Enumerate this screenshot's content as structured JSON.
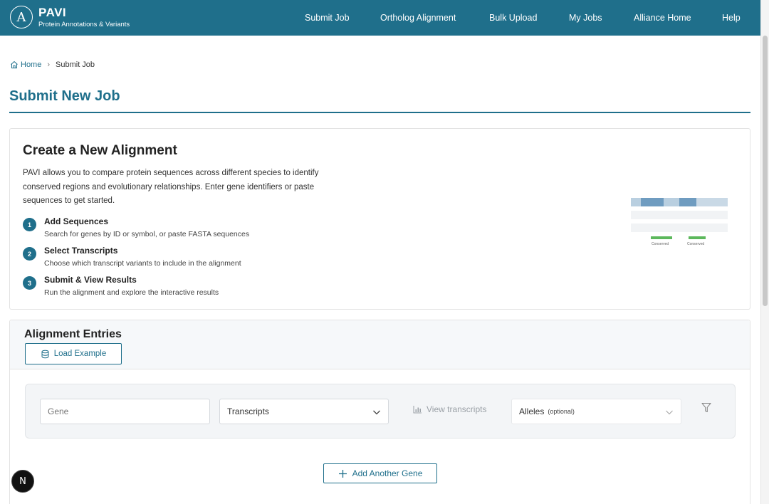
{
  "header": {
    "brand_title": "PAVI",
    "brand_subtitle": "Protein Annotations & Variants",
    "logo_glyph": "A",
    "nav": [
      "Submit Job",
      "Ortholog Alignment",
      "Bulk Upload",
      "My Jobs",
      "Alliance Home",
      "Help"
    ],
    "bg_color": "#1f6f8b"
  },
  "breadcrumb": {
    "home": "Home",
    "current": "Submit Job"
  },
  "page_title": "Submit New Job",
  "intro": {
    "title": "Create a New Alignment",
    "description": "PAVI allows you to compare protein sequences across different species to identify conserved regions and evolutionary relationships. Enter gene identifiers or paste sequences to get started.",
    "steps": [
      {
        "num": "1",
        "title": "Add Sequences",
        "desc": "Search for genes by ID or symbol, or paste FASTA sequences"
      },
      {
        "num": "2",
        "title": "Select Transcripts",
        "desc": "Choose which transcript variants to include in the alignment"
      },
      {
        "num": "3",
        "title": "Submit & View Results",
        "desc": "Run the alignment and explore the interactive results"
      }
    ],
    "illustration_labels": [
      "Conserved",
      "Conserved"
    ]
  },
  "entries": {
    "title": "Alignment Entries",
    "load_example": "Load Example",
    "gene_placeholder": "Gene",
    "transcripts_label": "Transcripts",
    "view_transcripts": "View transcripts",
    "alleles_label": "Alleles",
    "alleles_optional": "(optional)",
    "add_gene": "Add Another Gene"
  },
  "floating_badge": "N",
  "colors": {
    "accent": "#1f6f8b",
    "conserved": "#5cb85c"
  }
}
